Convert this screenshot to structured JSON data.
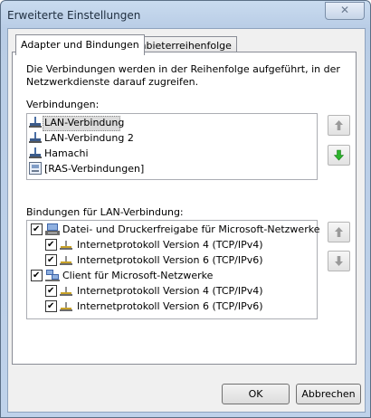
{
  "window": {
    "title": "Erweiterte Einstellungen",
    "close_glyph": "✕"
  },
  "tabs": [
    {
      "label": "Adapter und Bindungen",
      "active": true
    },
    {
      "label": "Anbieterreihenfolge",
      "active": false
    }
  ],
  "panel": {
    "description_line1": "Die Verbindungen werden in der Reihenfolge aufgeführt, in der",
    "description_line2": "Netzwerkdienste darauf zugreifen.",
    "connections_label": "Verbindungen:",
    "connections": [
      {
        "label": "LAN-Verbindung",
        "icon": "network-adapter-icon",
        "selected": true
      },
      {
        "label": "LAN-Verbindung 2",
        "icon": "network-adapter-icon",
        "selected": false
      },
      {
        "label": "Hamachi",
        "icon": "network-adapter-icon",
        "selected": false
      },
      {
        "label": "[RAS-Verbindungen]",
        "icon": "dialup-connections-icon",
        "selected": false
      }
    ],
    "bindings_label": "Bindungen für LAN-Verbindung:",
    "bindings": [
      {
        "label": "Datei- und Druckerfreigabe für Microsoft-Netzwerke",
        "checked": true,
        "level": 0,
        "icon": "file-printer-sharing-icon"
      },
      {
        "label": "Internetprotokoll Version 4 (TCP/IPv4)",
        "checked": true,
        "level": 1,
        "icon": "protocol-icon"
      },
      {
        "label": "Internetprotokoll Version 6 (TCP/IPv6)",
        "checked": true,
        "level": 1,
        "icon": "protocol-icon"
      },
      {
        "label": "Client für Microsoft-Netzwerke",
        "checked": true,
        "level": 0,
        "icon": "network-client-icon"
      },
      {
        "label": "Internetprotokoll Version 4 (TCP/IPv4)",
        "checked": true,
        "level": 1,
        "icon": "protocol-icon"
      },
      {
        "label": "Internetprotokoll Version 6 (TCP/IPv6)",
        "checked": true,
        "level": 1,
        "icon": "protocol-icon"
      }
    ]
  },
  "buttons": {
    "ok": "OK",
    "cancel": "Abbrechen"
  },
  "colors": {
    "window_frame": "#bfd2ea",
    "arrow_enabled": "#2db52d",
    "arrow_disabled": "#9a9a9a"
  }
}
